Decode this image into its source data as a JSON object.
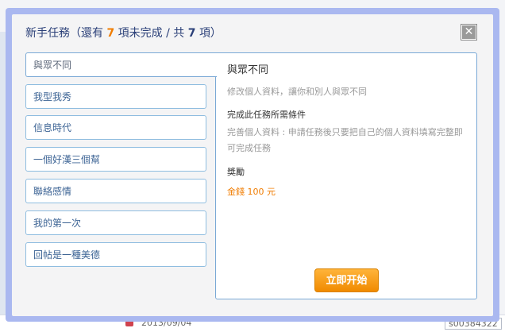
{
  "background": {
    "date_text": "2013/09/04",
    "code_text": "s00384322"
  },
  "modal": {
    "title_prefix": "新手任務（還有",
    "remaining_count": "7",
    "title_middle": "項未完成 / 共",
    "total_count": "7",
    "title_suffix": "項）",
    "close_symbol": "✕"
  },
  "tasks": [
    {
      "label": "與眾不同"
    },
    {
      "label": "我型我秀"
    },
    {
      "label": "信息時代"
    },
    {
      "label": "一個好漢三個幫"
    },
    {
      "label": "聯絡感情"
    },
    {
      "label": "我的第一次"
    },
    {
      "label": "回帖是一種美德"
    }
  ],
  "detail": {
    "title": "與眾不同",
    "description": "修改個人資料，讓你和別人與眾不同",
    "condition_heading": "完成此任務所需條件",
    "condition_text": "完善個人資料 : 申請任務後只要把自己的個人資料填寫完整即可完成任務",
    "reward_heading": "獎勵",
    "reward_text": "金錢 100 元",
    "start_label": "立即开始"
  },
  "colors": {
    "accent": "#f07c00",
    "title_blue": "#2a3f78",
    "border_blue": "#8fbde0",
    "frame": "#aab8f0"
  }
}
